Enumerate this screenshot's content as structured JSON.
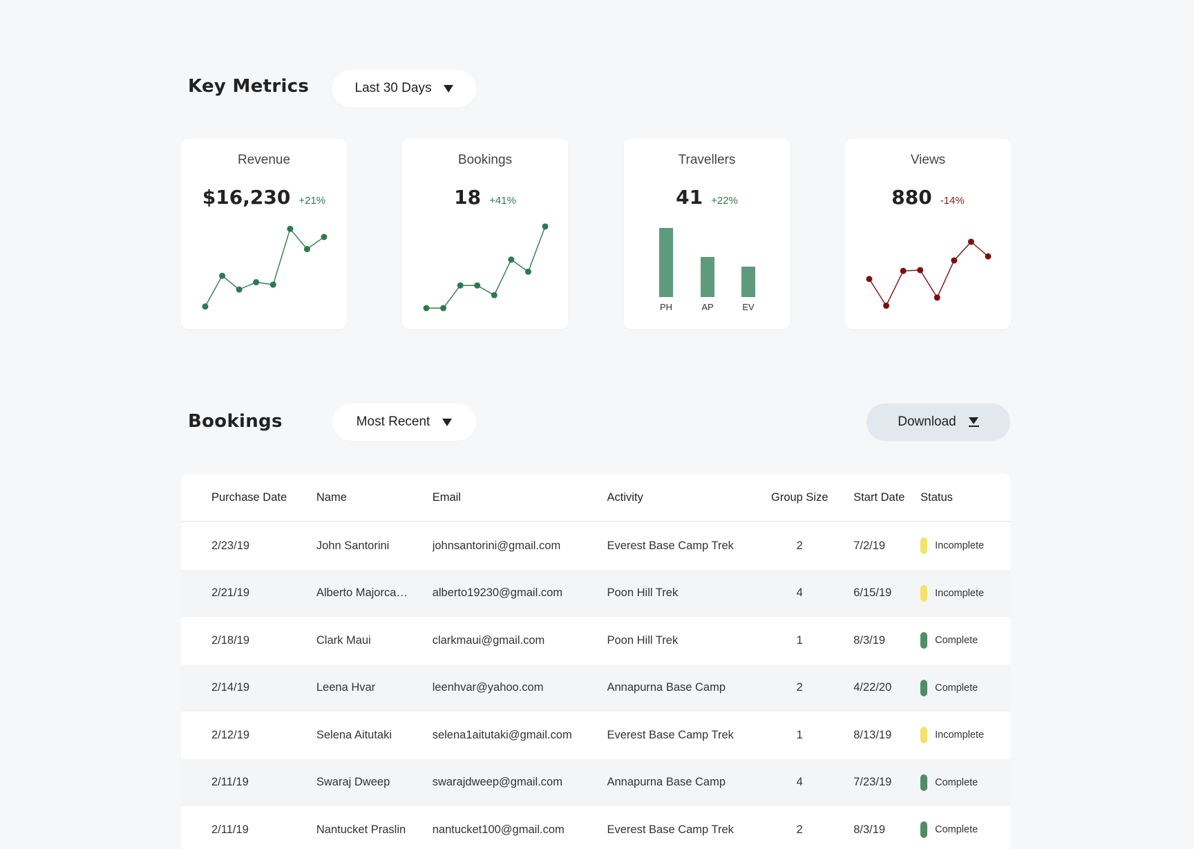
{
  "metrics": {
    "title": "Key Metrics",
    "range_label": "Last 30 Days",
    "cards": [
      {
        "title": "Revenue",
        "value": "$16,230",
        "delta": "+21%",
        "trend": "positive",
        "kind": "line",
        "color": "#2e7a4d",
        "points": [
          2,
          40,
          23,
          32,
          29,
          98,
          73,
          88
        ]
      },
      {
        "title": "Bookings",
        "value": "18",
        "delta": "+41%",
        "trend": "positive",
        "kind": "line",
        "color": "#2e7a4d",
        "points": [
          0,
          0,
          28,
          28,
          16,
          60,
          45,
          101
        ]
      },
      {
        "title": "Travellers",
        "value": "41",
        "delta": "+22%",
        "trend": "positive",
        "kind": "bar",
        "color": "#5e9a7c",
        "categories": [
          "PH",
          "AP",
          "EV"
        ],
        "values": [
          100,
          58,
          44
        ]
      },
      {
        "title": "Views",
        "value": "880",
        "delta": "-14%",
        "trend": "negative",
        "kind": "line",
        "color": "#7a1010",
        "points": [
          36,
          3,
          46,
          47,
          13,
          59,
          82,
          64
        ]
      }
    ]
  },
  "bookings": {
    "title": "Bookings",
    "sort_label": "Most Recent",
    "download_label": "Download",
    "columns": [
      "Purchase Date",
      "Name",
      "Email",
      "Activity",
      "Group Size",
      "Start Date",
      "Status"
    ],
    "status_colors": {
      "Incomplete": "#f3e36a",
      "Complete": "#4f8c6b"
    },
    "rows": [
      [
        "2/23/19",
        "John Santorini",
        "johnsantorini@gmail.com",
        "Everest Base Camp Trek",
        "2",
        "7/2/19",
        "Incomplete"
      ],
      [
        "2/21/19",
        "Alberto Majorca…",
        "alberto19230@gmail.com",
        "Poon Hill Trek",
        "4",
        "6/15/19",
        "Incomplete"
      ],
      [
        "2/18/19",
        "Clark Maui",
        "clarkmaui@gmail.com",
        "Poon Hill Trek",
        "1",
        "8/3/19",
        "Complete"
      ],
      [
        "2/14/19",
        "Leena Hvar",
        "leenhvar@yahoo.com",
        "Annapurna Base Camp",
        "2",
        "4/22/20",
        "Complete"
      ],
      [
        "2/12/19",
        "Selena Aitutaki",
        "selena1aitutaki@gmail.com",
        "Everest Base Camp Trek",
        "1",
        "8/13/19",
        "Incomplete"
      ],
      [
        "2/11/19",
        "Swaraj Dweep",
        "swarajdweep@gmail.com",
        "Annapurna Base Camp",
        "4",
        "7/23/19",
        "Complete"
      ],
      [
        "2/11/19",
        "Nantucket Praslin",
        "nantucket100@gmail.com",
        "Everest Base Camp Trek",
        "2",
        "8/3/19",
        "Complete"
      ]
    ]
  }
}
